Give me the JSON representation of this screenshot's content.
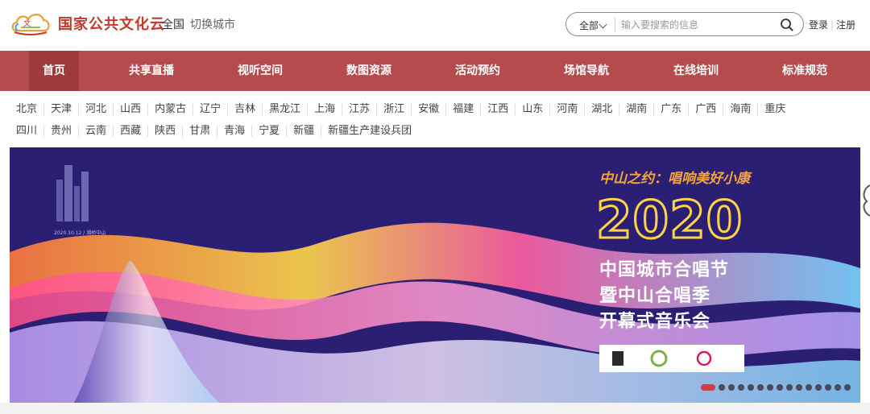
{
  "header": {
    "brand": "国家公共文化云",
    "region": "全国",
    "switch_city": "切换城市",
    "search": {
      "scope": "全部",
      "placeholder": "输入要搜索的信息"
    },
    "auth": {
      "login": "登录",
      "register": "注册"
    }
  },
  "nav": {
    "items": [
      {
        "label": "首页",
        "active": true
      },
      {
        "label": "共享直播"
      },
      {
        "label": "视听空间"
      },
      {
        "label": "数图资源"
      },
      {
        "label": "活动预约"
      },
      {
        "label": "场馆导航"
      },
      {
        "label": "在线培训"
      },
      {
        "label": "标准规范"
      }
    ]
  },
  "provinces": {
    "row1": [
      "北京",
      "天津",
      "河北",
      "山西",
      "内蒙古",
      "辽宁",
      "吉林",
      "黑龙江",
      "上海",
      "江苏",
      "浙江",
      "安徽",
      "福建",
      "江西",
      "山东",
      "河南",
      "湖北",
      "湖南",
      "广东",
      "广西",
      "海南",
      "重庆"
    ],
    "row2": [
      "四川",
      "贵州",
      "云南",
      "西藏",
      "陕西",
      "甘肃",
      "青海",
      "宁夏",
      "新疆",
      "新疆生产建设兵团"
    ]
  },
  "banner": {
    "slogan": "中山之约：唱响美好小康",
    "year": "2020",
    "title_line1": "中国城市合唱节",
    "title_line2": "暨中山合唱季",
    "title_line3": "开幕式音乐会",
    "small_caption": "2020.10.12 / 湘桥中山",
    "slide_count": 15,
    "active_slide": 0
  },
  "colors": {
    "nav_bg": "#b54b4c",
    "nav_active": "#9e3a3b",
    "banner_bg": "#2a1f73",
    "dot_active": "#d23a4a"
  }
}
